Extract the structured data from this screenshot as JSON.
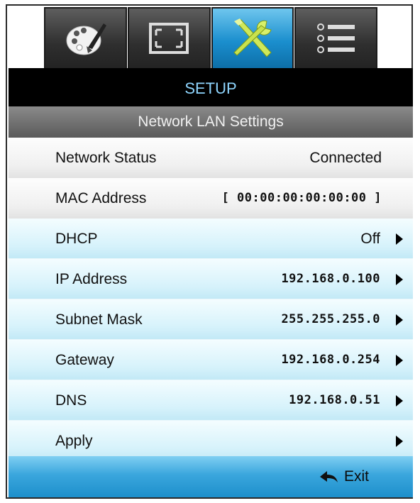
{
  "tabs": [
    {
      "icon": "palette-icon",
      "active": false
    },
    {
      "icon": "screen-resize-icon",
      "active": false
    },
    {
      "icon": "tools-icon",
      "active": true
    },
    {
      "icon": "menu-list-icon",
      "active": false
    }
  ],
  "header": {
    "title": "SETUP",
    "subtitle": "Network LAN Settings"
  },
  "rows": [
    {
      "label": "Network Status",
      "value": "Connected"
    },
    {
      "label": "MAC Address",
      "value": "[ 00:00:00:00:00:00 ]"
    },
    {
      "label": "DHCP",
      "value": "Off"
    },
    {
      "label": "IP Address",
      "value": "192.168.0.100"
    },
    {
      "label": "Subnet Mask",
      "value": "255.255.255.0"
    },
    {
      "label": "Gateway",
      "value": "192.168.0.254"
    },
    {
      "label": "DNS",
      "value": "192.168.0.51"
    },
    {
      "label": "Apply",
      "value": ""
    }
  ],
  "footer": {
    "exit_label": "Exit",
    "exit_icon": "back-arrow-icon"
  },
  "colors": {
    "accent": "#1b8fce",
    "header_bg": "#000000",
    "header_text": "#8fd6ff"
  }
}
